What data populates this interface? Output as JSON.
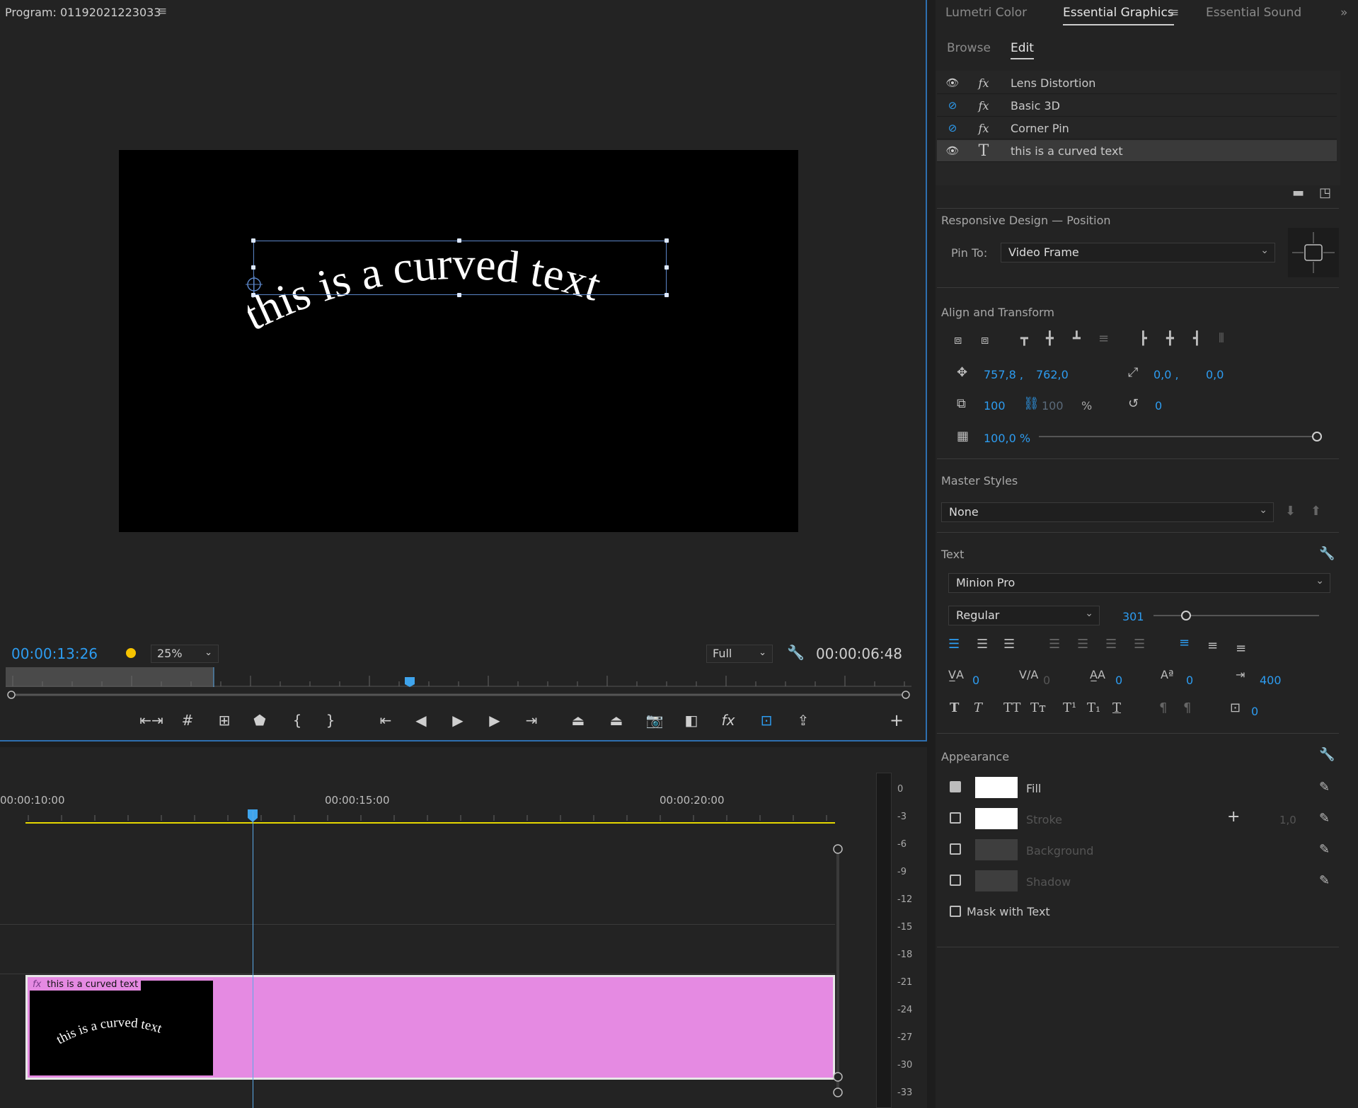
{
  "program": {
    "title": "Program: 01192021223033",
    "menu_icon": "hamburger-menu-icon",
    "video_text": "this is a curved text",
    "timecode_current": "00:00:13:26",
    "zoom": "25%",
    "quality": "Full",
    "timecode_duration": "00:00:06:48",
    "playback_dot_color": "#f6c300"
  },
  "panel_tabs": {
    "lumetri": "Lumetri Color",
    "essential_graphics": "Essential Graphics",
    "essential_sound": "Essential Sound",
    "more": "»"
  },
  "subtabs": {
    "browse": "Browse",
    "edit": "Edit"
  },
  "layers": [
    {
      "name": "Lens Distortion",
      "type": "fx",
      "visible": true
    },
    {
      "name": "Basic 3D",
      "type": "fx",
      "visible": false
    },
    {
      "name": "Corner Pin",
      "type": "fx",
      "visible": false
    },
    {
      "name": "this is a curved text",
      "type": "text",
      "visible": true
    }
  ],
  "responsive": {
    "title": "Responsive Design — Position",
    "pin_label": "Pin To:",
    "pin_value": "Video Frame"
  },
  "align": {
    "title": "Align and Transform",
    "pos_x": "757,8 ,",
    "pos_y": "762,0",
    "anchor_x": "0,0 ,",
    "anchor_y": "0,0",
    "scale": "100",
    "scale_linked": "100",
    "percent": "%",
    "rotation": "0",
    "opacity": "100,0 %",
    "opacity_level": 1.0
  },
  "master_styles": {
    "title": "Master Styles",
    "value": "None"
  },
  "text": {
    "title": "Text",
    "font": "Minion Pro",
    "style": "Regular",
    "size": "301",
    "kerning": "0",
    "tracking": "0",
    "leading": "0",
    "baseline": "0",
    "tab_width": "400",
    "tsume": "0"
  },
  "appearance": {
    "title": "Appearance",
    "fill": {
      "label": "Fill",
      "checked": true
    },
    "stroke": {
      "label": "Stroke",
      "checked": false,
      "width": "1,0"
    },
    "background": {
      "label": "Background",
      "checked": false
    },
    "shadow": {
      "label": "Shadow",
      "checked": false
    },
    "mask": {
      "label": "Mask with Text",
      "checked": false
    }
  },
  "timeline": {
    "ruler": [
      "00:00:10:00",
      "00:00:15:00",
      "00:00:20:00"
    ],
    "clip_label": "this is a curved text",
    "clip_color": "#e58ae2",
    "meter_labels": [
      "0",
      "-3",
      "-6",
      "-9",
      "-12",
      "-15",
      "-18",
      "-21",
      "-24",
      "-27",
      "-30",
      "-33"
    ]
  }
}
